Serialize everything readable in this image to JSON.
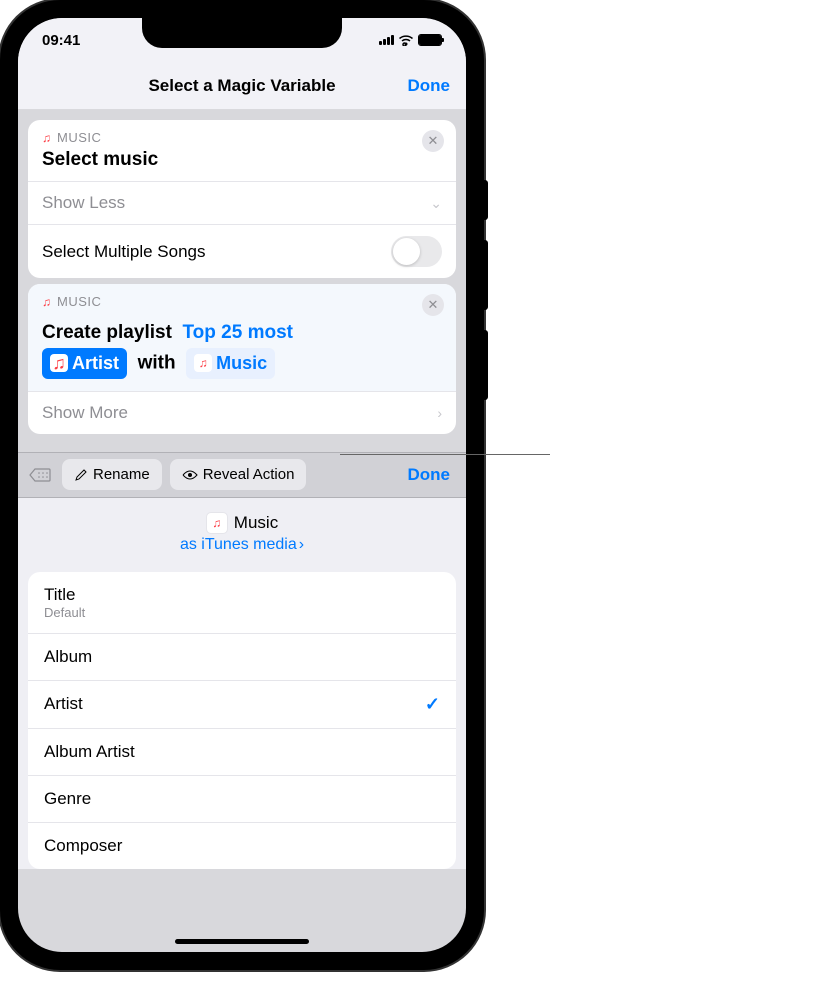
{
  "status": {
    "time": "09:41"
  },
  "nav": {
    "title": "Select a Magic Variable",
    "done": "Done"
  },
  "card1": {
    "app": "MUSIC",
    "title": "Select music",
    "showLess": "Show Less",
    "multiSongs": "Select Multiple Songs"
  },
  "card2": {
    "app": "MUSIC",
    "createPlaylist": "Create playlist",
    "top25": "Top 25 most",
    "artist": "Artist",
    "with": "with",
    "music": "Music",
    "showMore": "Show More"
  },
  "toolbar": {
    "rename": "Rename",
    "reveal": "Reveal Action",
    "done": "Done"
  },
  "varHeader": {
    "name": "Music",
    "link": "as iTunes media"
  },
  "list": {
    "items": [
      {
        "label": "Title",
        "sub": "Default",
        "checked": false
      },
      {
        "label": "Album",
        "sub": "",
        "checked": false
      },
      {
        "label": "Artist",
        "sub": "",
        "checked": true
      },
      {
        "label": "Album Artist",
        "sub": "",
        "checked": false
      },
      {
        "label": "Genre",
        "sub": "",
        "checked": false
      },
      {
        "label": "Composer",
        "sub": "",
        "checked": false
      }
    ]
  }
}
